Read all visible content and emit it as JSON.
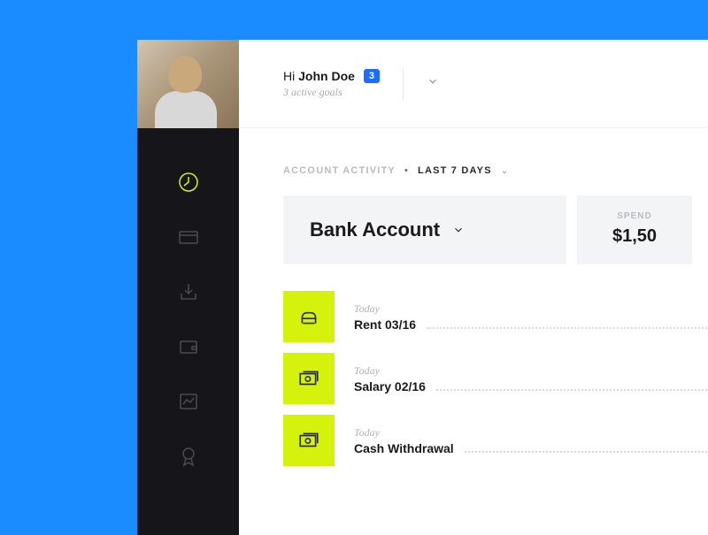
{
  "header": {
    "greeting_prefix": "Hi ",
    "user_name": "John Doe",
    "badge": "3",
    "subtext": "3 active goals"
  },
  "section": {
    "label": "ACCOUNT ACTIVITY",
    "range": "LAST 7 DAYS"
  },
  "account_card": {
    "title": "Bank Account"
  },
  "spend_card": {
    "label": "SPEND",
    "value": "$1,50"
  },
  "transactions": [
    {
      "date": "Today",
      "title": "Rent 03/16",
      "icon": "home"
    },
    {
      "date": "Today",
      "title": "Salary 02/16",
      "icon": "money"
    },
    {
      "date": "Today",
      "title": "Cash Withdrawal",
      "icon": "money"
    }
  ],
  "nav": {
    "items": [
      "activity",
      "card",
      "inbox",
      "wallet",
      "chart",
      "award"
    ],
    "active": "activity"
  }
}
